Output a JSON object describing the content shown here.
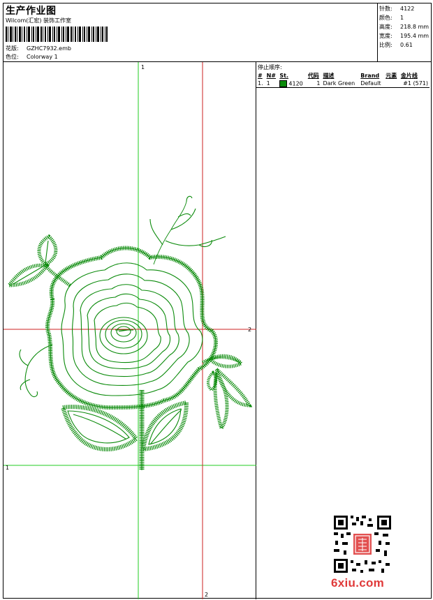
{
  "header": {
    "title": "生产作业图",
    "studio": "Wilcom(汇宏) 装饰工作室",
    "design_label": "花版:",
    "design_value": "GZHC7932.emb",
    "colorway_label": "色位:",
    "colorway_value": "Colorway 1"
  },
  "stats": {
    "stitches_label": "针数:",
    "stitches_value": "4122",
    "colors_label": "颜色:",
    "colors_value": "1",
    "height_label": "高度:",
    "height_value": "218.8 mm",
    "width_label": "宽度:",
    "width_value": "195.4 mm",
    "scale_label": "比例:",
    "scale_value": "0.61"
  },
  "stop_sequence": {
    "title": "停止顺序:",
    "columns": [
      "#",
      "N#",
      "St.",
      "代码",
      "描述",
      "Brand",
      "元素",
      "金片线"
    ],
    "rows": [
      {
        "index": "1.",
        "needle": "1",
        "swatch_color": "#0a8a0a",
        "stitches": "4120",
        "code": "1",
        "description": "Dark Green",
        "brand": "Default",
        "element": "",
        "sequin": "#1 (571)"
      }
    ]
  },
  "guides": {
    "vertical_green_top": "1",
    "horizontal_red_right": "2",
    "horizontal_green_left": "1",
    "vertical_red_bottom": "2"
  },
  "colors": {
    "thread": "#0a8a0a",
    "guide_green": "#22cc22",
    "guide_red": "#cc2222",
    "watermark": "#e03a3a"
  },
  "watermark": "6xiu.com",
  "icons": {
    "qr": "qr-code-icon",
    "seal": "red-seal-stamp"
  }
}
